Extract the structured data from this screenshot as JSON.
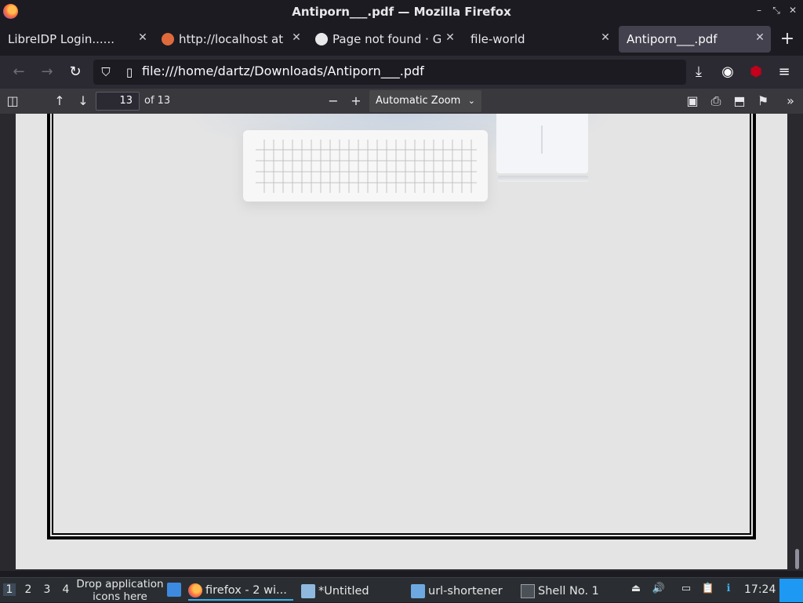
{
  "window": {
    "title": "Antiporn___.pdf — Mozilla Firefox",
    "controls": [
      "–",
      "⤡",
      "✕"
    ]
  },
  "tabs": [
    {
      "label": "LibreIDP Login......",
      "active": false
    },
    {
      "label": "http://localhost at [",
      "active": false
    },
    {
      "label": "Page not found · G",
      "active": false
    },
    {
      "label": "file-world",
      "active": false
    },
    {
      "label": "Antiporn___.pdf",
      "active": true
    }
  ],
  "newtab_label": "+",
  "navbar": {
    "url": "file:///home/dartz/Downloads/Antiporn___.pdf",
    "icons": [
      "back-icon",
      "forward-icon",
      "reload-icon",
      "shield-icon",
      "page-icon",
      "star-icon",
      "download-icon",
      "extension-icon",
      "ublock-icon",
      "menu-icon"
    ]
  },
  "pdf_toolbar": {
    "page_number": "13",
    "page_of": "of 13",
    "zoom": "Automatic Zoom",
    "zoom_minus": "−",
    "zoom_plus": "+"
  },
  "taskbar": {
    "workspaces": [
      "1",
      "2",
      "3",
      "4"
    ],
    "drop_hint_line1": "Drop application",
    "drop_hint_line2": "icons here",
    "tasks": [
      {
        "label": "firefox - 2 wi...",
        "active": true
      },
      {
        "label": "*Untitled",
        "active": false
      },
      {
        "label": "url-shortener",
        "active": false
      },
      {
        "label": "Shell No. 1",
        "active": false
      }
    ],
    "clock": "17:24"
  },
  "colors": {
    "accent": "#3daee9",
    "toolbar": "#2b2a33",
    "pdf_page": "#e4e4e4"
  }
}
